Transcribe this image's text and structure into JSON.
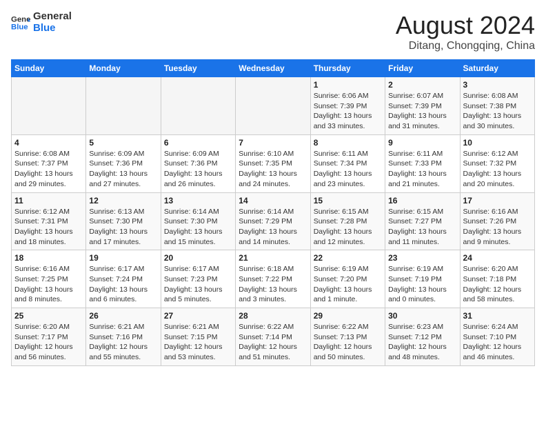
{
  "header": {
    "logo_line1": "General",
    "logo_line2": "Blue",
    "month_year": "August 2024",
    "location": "Ditang, Chongqing, China"
  },
  "weekdays": [
    "Sunday",
    "Monday",
    "Tuesday",
    "Wednesday",
    "Thursday",
    "Friday",
    "Saturday"
  ],
  "weeks": [
    [
      {
        "day": "",
        "info": ""
      },
      {
        "day": "",
        "info": ""
      },
      {
        "day": "",
        "info": ""
      },
      {
        "day": "",
        "info": ""
      },
      {
        "day": "1",
        "info": "Sunrise: 6:06 AM\nSunset: 7:39 PM\nDaylight: 13 hours\nand 33 minutes."
      },
      {
        "day": "2",
        "info": "Sunrise: 6:07 AM\nSunset: 7:39 PM\nDaylight: 13 hours\nand 31 minutes."
      },
      {
        "day": "3",
        "info": "Sunrise: 6:08 AM\nSunset: 7:38 PM\nDaylight: 13 hours\nand 30 minutes."
      }
    ],
    [
      {
        "day": "4",
        "info": "Sunrise: 6:08 AM\nSunset: 7:37 PM\nDaylight: 13 hours\nand 29 minutes."
      },
      {
        "day": "5",
        "info": "Sunrise: 6:09 AM\nSunset: 7:36 PM\nDaylight: 13 hours\nand 27 minutes."
      },
      {
        "day": "6",
        "info": "Sunrise: 6:09 AM\nSunset: 7:36 PM\nDaylight: 13 hours\nand 26 minutes."
      },
      {
        "day": "7",
        "info": "Sunrise: 6:10 AM\nSunset: 7:35 PM\nDaylight: 13 hours\nand 24 minutes."
      },
      {
        "day": "8",
        "info": "Sunrise: 6:11 AM\nSunset: 7:34 PM\nDaylight: 13 hours\nand 23 minutes."
      },
      {
        "day": "9",
        "info": "Sunrise: 6:11 AM\nSunset: 7:33 PM\nDaylight: 13 hours\nand 21 minutes."
      },
      {
        "day": "10",
        "info": "Sunrise: 6:12 AM\nSunset: 7:32 PM\nDaylight: 13 hours\nand 20 minutes."
      }
    ],
    [
      {
        "day": "11",
        "info": "Sunrise: 6:12 AM\nSunset: 7:31 PM\nDaylight: 13 hours\nand 18 minutes."
      },
      {
        "day": "12",
        "info": "Sunrise: 6:13 AM\nSunset: 7:30 PM\nDaylight: 13 hours\nand 17 minutes."
      },
      {
        "day": "13",
        "info": "Sunrise: 6:14 AM\nSunset: 7:30 PM\nDaylight: 13 hours\nand 15 minutes."
      },
      {
        "day": "14",
        "info": "Sunrise: 6:14 AM\nSunset: 7:29 PM\nDaylight: 13 hours\nand 14 minutes."
      },
      {
        "day": "15",
        "info": "Sunrise: 6:15 AM\nSunset: 7:28 PM\nDaylight: 13 hours\nand 12 minutes."
      },
      {
        "day": "16",
        "info": "Sunrise: 6:15 AM\nSunset: 7:27 PM\nDaylight: 13 hours\nand 11 minutes."
      },
      {
        "day": "17",
        "info": "Sunrise: 6:16 AM\nSunset: 7:26 PM\nDaylight: 13 hours\nand 9 minutes."
      }
    ],
    [
      {
        "day": "18",
        "info": "Sunrise: 6:16 AM\nSunset: 7:25 PM\nDaylight: 13 hours\nand 8 minutes."
      },
      {
        "day": "19",
        "info": "Sunrise: 6:17 AM\nSunset: 7:24 PM\nDaylight: 13 hours\nand 6 minutes."
      },
      {
        "day": "20",
        "info": "Sunrise: 6:17 AM\nSunset: 7:23 PM\nDaylight: 13 hours\nand 5 minutes."
      },
      {
        "day": "21",
        "info": "Sunrise: 6:18 AM\nSunset: 7:22 PM\nDaylight: 13 hours\nand 3 minutes."
      },
      {
        "day": "22",
        "info": "Sunrise: 6:19 AM\nSunset: 7:20 PM\nDaylight: 13 hours\nand 1 minute."
      },
      {
        "day": "23",
        "info": "Sunrise: 6:19 AM\nSunset: 7:19 PM\nDaylight: 13 hours\nand 0 minutes."
      },
      {
        "day": "24",
        "info": "Sunrise: 6:20 AM\nSunset: 7:18 PM\nDaylight: 12 hours\nand 58 minutes."
      }
    ],
    [
      {
        "day": "25",
        "info": "Sunrise: 6:20 AM\nSunset: 7:17 PM\nDaylight: 12 hours\nand 56 minutes."
      },
      {
        "day": "26",
        "info": "Sunrise: 6:21 AM\nSunset: 7:16 PM\nDaylight: 12 hours\nand 55 minutes."
      },
      {
        "day": "27",
        "info": "Sunrise: 6:21 AM\nSunset: 7:15 PM\nDaylight: 12 hours\nand 53 minutes."
      },
      {
        "day": "28",
        "info": "Sunrise: 6:22 AM\nSunset: 7:14 PM\nDaylight: 12 hours\nand 51 minutes."
      },
      {
        "day": "29",
        "info": "Sunrise: 6:22 AM\nSunset: 7:13 PM\nDaylight: 12 hours\nand 50 minutes."
      },
      {
        "day": "30",
        "info": "Sunrise: 6:23 AM\nSunset: 7:12 PM\nDaylight: 12 hours\nand 48 minutes."
      },
      {
        "day": "31",
        "info": "Sunrise: 6:24 AM\nSunset: 7:10 PM\nDaylight: 12 hours\nand 46 minutes."
      }
    ]
  ]
}
